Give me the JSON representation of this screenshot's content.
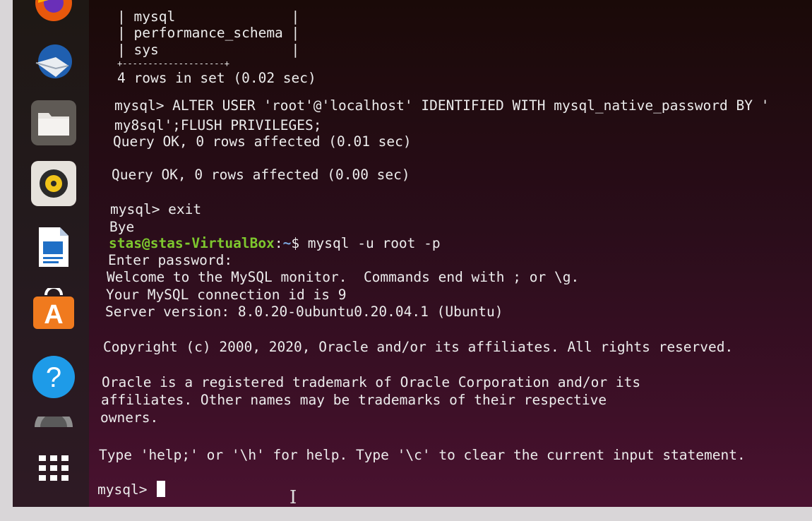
{
  "dock": {
    "items": [
      {
        "icon": "firefox-icon"
      },
      {
        "icon": "thunderbird-icon"
      },
      {
        "icon": "files-icon"
      },
      {
        "icon": "rhythmbox-icon"
      },
      {
        "icon": "writer-icon"
      },
      {
        "icon": "software-center-icon"
      },
      {
        "icon": "help-icon",
        "glyph": "?"
      },
      {
        "icon": "disk-icon"
      },
      {
        "icon": "app-grid-icon"
      }
    ],
    "appstore_glyph": "A"
  },
  "terminal": {
    "table_rows": [
      "| mysql              |",
      "| performance_schema |",
      "| sys                |"
    ],
    "table_border": "+--------------------+",
    "rows_summary": "4 rows in set (0.02 sec)",
    "alter_line1": "mysql> ALTER USER 'root'@'localhost' IDENTIFIED WITH mysql_native_password BY '",
    "alter_line2": "my8sql';FLUSH PRIVILEGES;",
    "query_ok1": "Query OK, 0 rows affected (0.01 sec)",
    "query_ok2": "Query OK, 0 rows affected (0.00 sec)",
    "exit_cmd": "mysql> exit",
    "bye": "Bye",
    "prompt_user": "stas@stas-VirtualBox",
    "prompt_colon": ":",
    "prompt_path": "~",
    "prompt_cmd": "$ mysql -u root -p",
    "enter_password": "Enter password:",
    "welcome": "Welcome to the MySQL monitor.  Commands end with ; or \\g.",
    "connection_id": "Your MySQL connection id is 9",
    "server_version": "Server version: 8.0.20-0ubuntu0.20.04.1 (Ubuntu)",
    "copyright": "Copyright (c) 2000, 2020, Oracle and/or its affiliates. All rights reserved.",
    "trademark1": "Oracle is a registered trademark of Oracle Corporation and/or its",
    "trademark2": "affiliates. Other names may be trademarks of their respective",
    "trademark3": "owners.",
    "help_line": "Type 'help;' or '\\h' for help. Type '\\c' to clear the current input statement.",
    "current_prompt": "mysql> "
  },
  "colors": {
    "prompt_user": "#7ec82e",
    "prompt_path": "#7aa6dd",
    "background": "#3a0f25"
  }
}
